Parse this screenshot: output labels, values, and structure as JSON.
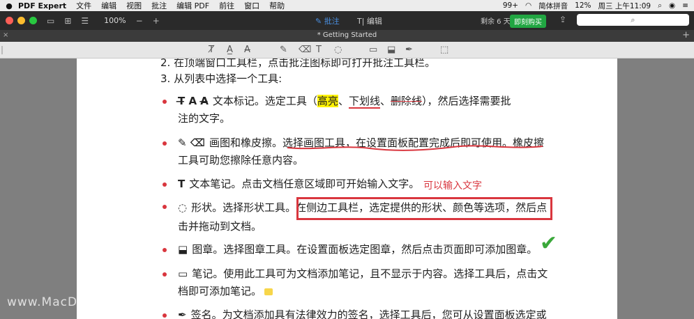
{
  "menubar": {
    "apple": "",
    "app_name": "PDF Expert",
    "items": [
      "文件",
      "编辑",
      "视图",
      "批注",
      "编辑 PDF",
      "前往",
      "窗口",
      "帮助"
    ],
    "notifications": "99+",
    "input_method": "简体拼音",
    "battery": "12%",
    "clock": "周三 上午11:09"
  },
  "toolbar": {
    "zoom": "100%",
    "zoom_out": "−",
    "zoom_in": "+",
    "annotate_tab": "批注",
    "edit_tab": "编辑",
    "trial": "剩余 6 天",
    "buy": "即刻购买",
    "search_icon": "⌕"
  },
  "tabbar": {
    "close": "×",
    "title": "* Getting Started",
    "add": "+"
  },
  "document": {
    "line_2": "2.  在顶端窗口工具栏，点击批注图标即可打开批注工具栏。",
    "line_3": "3.  从列表中选择一个工具:",
    "b1_icons": "T̶  A  A̶",
    "b1_pre": "文本标记。选定工具（",
    "b1_hl": "高亮",
    "b1_sep1": "、",
    "b1_ul": "下划线",
    "b1_sep2": "、",
    "b1_st": "删除线",
    "b1_post": "），然后选择需要批",
    "b1_line2": "注的文字。",
    "b2_icons": "✎  ⌫",
    "b2_text": "画图和橡皮擦。选择画图工具，在设置面板配置完成后即可使用。橡皮擦",
    "b2_line2": "工具可助您擦除任意内容。",
    "b3_icon": "T",
    "b3_text": "文本笔记。点击文档任意区域即可开始输入文字。",
    "b3_annotation": "可以输入文字",
    "b4_icon": "◌",
    "b4_pre": "形状。选择形状工具。",
    "b4_boxed": "在侧边工具栏，选定提供的形状、颜色等选项，然后点",
    "b4_line2": "击并拖动到文档。",
    "b5_icon": "⬓",
    "b5_text": "图章。选择图章工具。在设置面板选定图章，然后点击页面即可添加图章。",
    "b5_check": "✔",
    "b6_icon": "▭",
    "b6_text": "笔记。使用此工具可为文档添加笔记，且不显示于内容。选择工具后，点击文",
    "b6_line2": "档即可添加笔记。",
    "b7_icon": "✒",
    "b7_text": "签名。为文档添加具有法律效力的签名，选择工具后，您可从设置面板选定或"
  },
  "watermark": "www.MacDown.com",
  "colors": {
    "accent": "#4a90e2",
    "buy_green": "#21a642",
    "annotation_red": "#d9363e",
    "highlight": "#fff200"
  }
}
